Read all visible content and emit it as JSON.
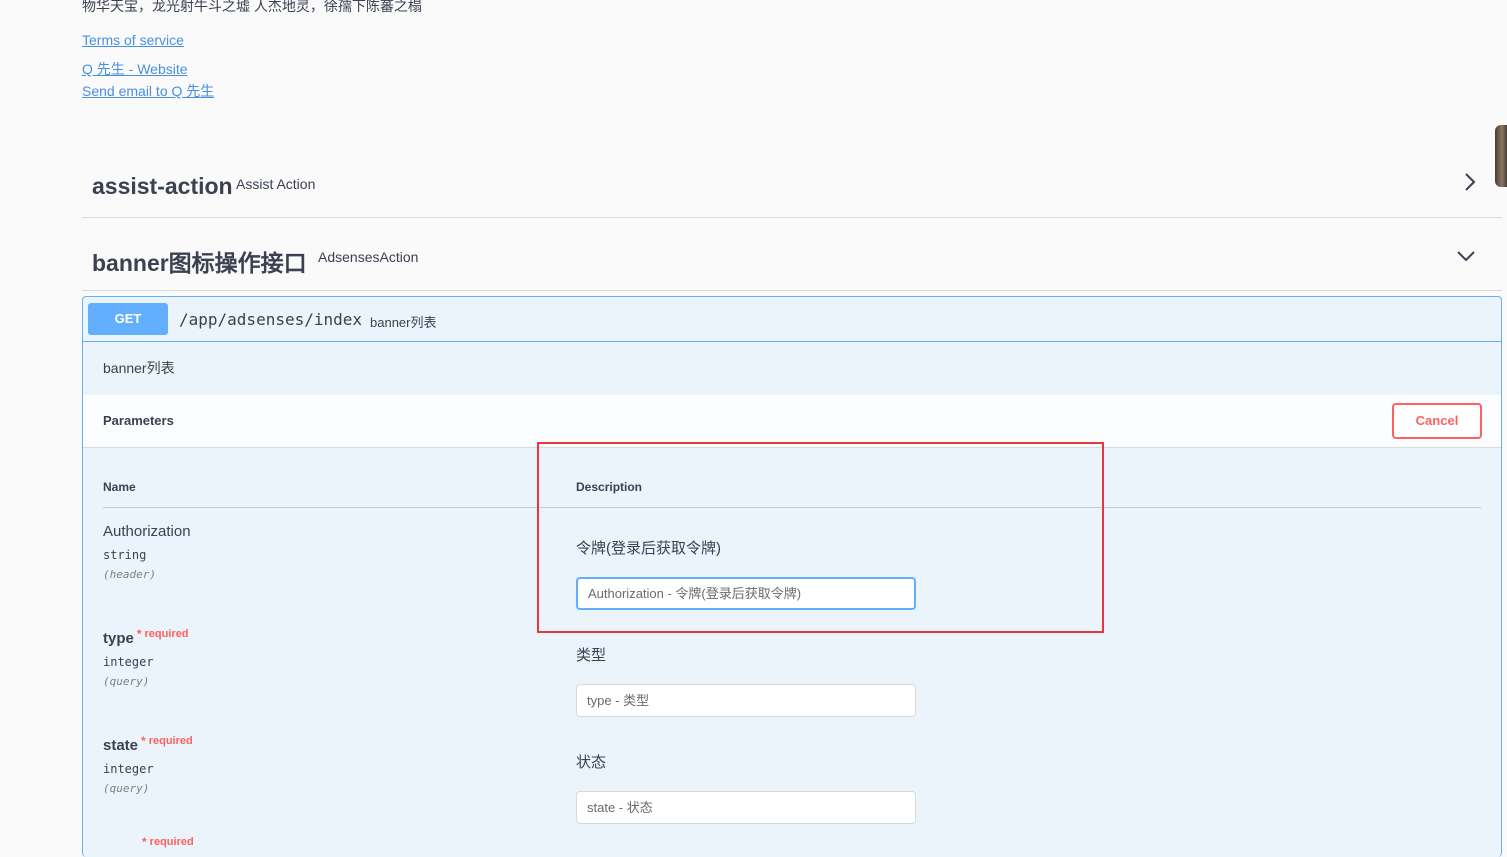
{
  "info": {
    "description": "物华天宝，龙光射牛斗之墟 人杰地灵，徐孺下陈蕃之榻",
    "links": {
      "terms": "Terms of service",
      "website": "Q 先生 - Website",
      "email": "Send email to Q 先生"
    }
  },
  "tags": [
    {
      "name": "assist-action",
      "description": "Assist Action",
      "expanded": false
    },
    {
      "name": "banner图标操作接口",
      "description": "AdsensesAction",
      "expanded": true
    }
  ],
  "operation": {
    "method": "GET",
    "path": "/app/adsenses/index",
    "summary": "banner列表",
    "description": "banner列表",
    "method_color": "#61affe"
  },
  "parameters_section": {
    "title": "Parameters",
    "cancel_label": "Cancel",
    "col_name": "Name",
    "col_description": "Description"
  },
  "parameters": [
    {
      "name": "Authorization",
      "type": "string",
      "in": "(header)",
      "required": false,
      "description": "令牌(登录后获取令牌)",
      "placeholder": "Authorization - 令牌(登录后获取令牌)"
    },
    {
      "name": "type",
      "type": "integer",
      "in": "(query)",
      "required": true,
      "required_label": "required",
      "description": "类型",
      "placeholder": "type - 类型"
    },
    {
      "name": "state",
      "type": "integer",
      "in": "(query)",
      "required": true,
      "required_label": "required",
      "description": "状态",
      "placeholder": "state - 状态"
    },
    {
      "required_label": "required"
    }
  ],
  "colors": {
    "accent": "#61affe",
    "danger": "#ff6060",
    "highlight": "#e8383d"
  }
}
